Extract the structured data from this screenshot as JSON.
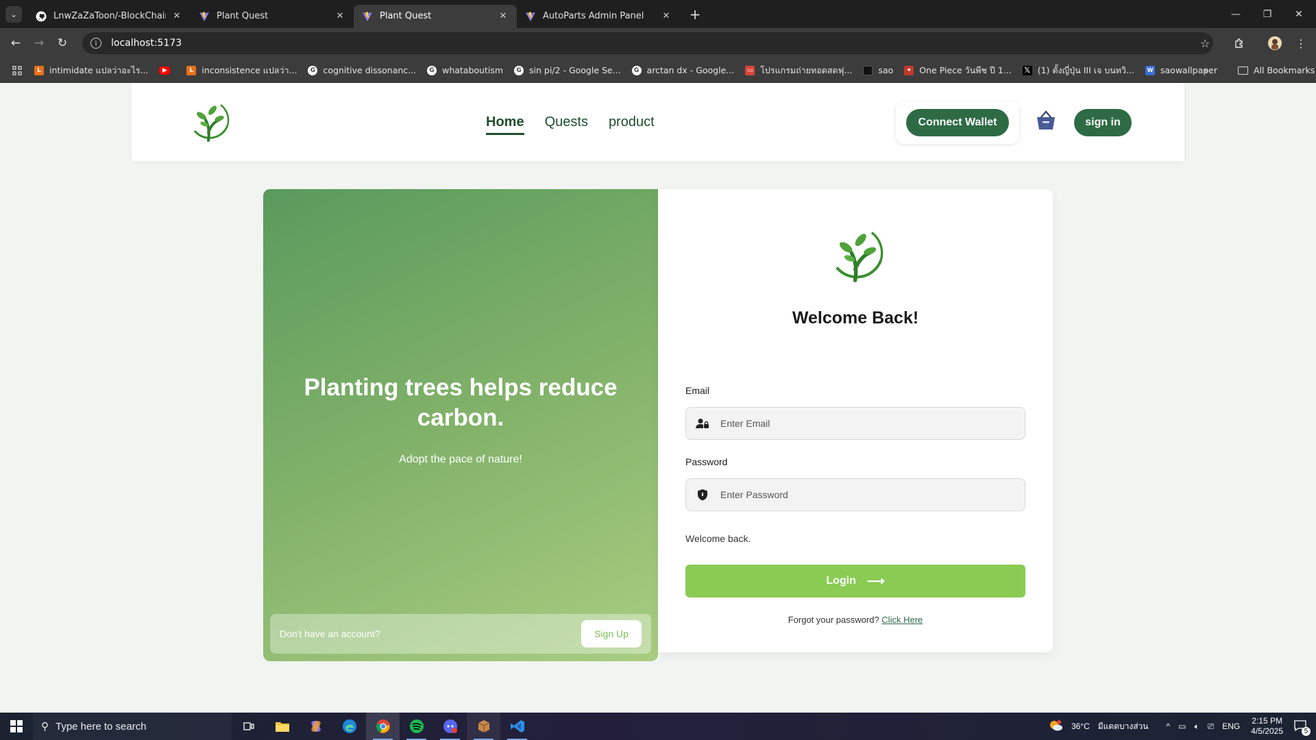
{
  "browser": {
    "tabs": [
      {
        "title": "LnwZaZaToon/-BlockChainPlant",
        "favicon": "github-icon",
        "active": false
      },
      {
        "title": "Plant Quest",
        "favicon": "vite-icon",
        "active": false
      },
      {
        "title": "Plant Quest",
        "favicon": "vite-icon",
        "active": true
      },
      {
        "title": "AutoParts Admin Panel",
        "favicon": "vite-icon",
        "active": false
      }
    ],
    "url": "localhost:5173",
    "bookmarks": [
      {
        "label": "intimidate แปลว่าอะไร...",
        "icon": "longdo-icon",
        "color": "#e8701a"
      },
      {
        "label": "",
        "icon": "youtube-icon",
        "color": "#ff0000"
      },
      {
        "label": "inconsistence แปลว่า...",
        "icon": "longdo-icon",
        "color": "#e8701a"
      },
      {
        "label": "cognitive dissonanc...",
        "icon": "google-icon",
        "color": "#ffffff"
      },
      {
        "label": "whataboutism",
        "icon": "google-icon",
        "color": "#ffffff"
      },
      {
        "label": "sin pi/2 - Google Se...",
        "icon": "google-icon",
        "color": "#ffffff"
      },
      {
        "label": "arctan dx - Google...",
        "icon": "google-icon",
        "color": "#ffffff"
      },
      {
        "label": "โปรแกรมถ่ายทอดสดฟุ...",
        "icon": "tv-icon",
        "color": "#d9453a"
      },
      {
        "label": "sao",
        "icon": "sao-icon",
        "color": "#111111"
      },
      {
        "label": "One Piece วันพีช ปี 1...",
        "icon": "manga-icon",
        "color": "#c0392b"
      },
      {
        "label": "(1) ตั้งญี่ปุ่น III เจ บนทวิ...",
        "icon": "x-icon",
        "color": "#000000"
      },
      {
        "label": "saowallpaper",
        "icon": "wallpaper-icon",
        "color": "#3b6fd6"
      }
    ],
    "all_bookmarks_label": "All Bookmarks"
  },
  "header": {
    "nav": [
      {
        "label": "Home",
        "active": true
      },
      {
        "label": "Quests",
        "active": false
      },
      {
        "label": "product",
        "active": false
      }
    ],
    "connect_wallet_label": "Connect Wallet",
    "signin_label": "sign in"
  },
  "promo": {
    "title": "Planting trees helps reduce carbon.",
    "subtitle": "Adopt the pace of nature!",
    "signup_prompt": "Don't have an account?",
    "signup_label": "Sign Up"
  },
  "login": {
    "title": "Welcome Back!",
    "email_label": "Email",
    "email_placeholder": "Enter Email",
    "password_label": "Password",
    "password_placeholder": "Enter Password",
    "status_message": "Welcome back.",
    "login_label": "Login",
    "forgot_text": "Forgot your password?",
    "forgot_link": "Click Here"
  },
  "taskbar": {
    "search_placeholder": "Type here to search",
    "weather": "36°C",
    "weather_location": "มีแดดบางส่วน",
    "language": "ENG",
    "time": "2:15 PM",
    "date": "4/5/2025",
    "notification_count": "5",
    "apps": [
      "task-view-icon",
      "file-explorer-icon",
      "copilot-icon",
      "edge-icon",
      "chrome-icon",
      "spotify-icon",
      "discord-icon",
      "package-icon",
      "vscode-icon"
    ]
  },
  "colors": {
    "brand_dark": "#2e6b45",
    "brand_light": "#8acb54"
  }
}
